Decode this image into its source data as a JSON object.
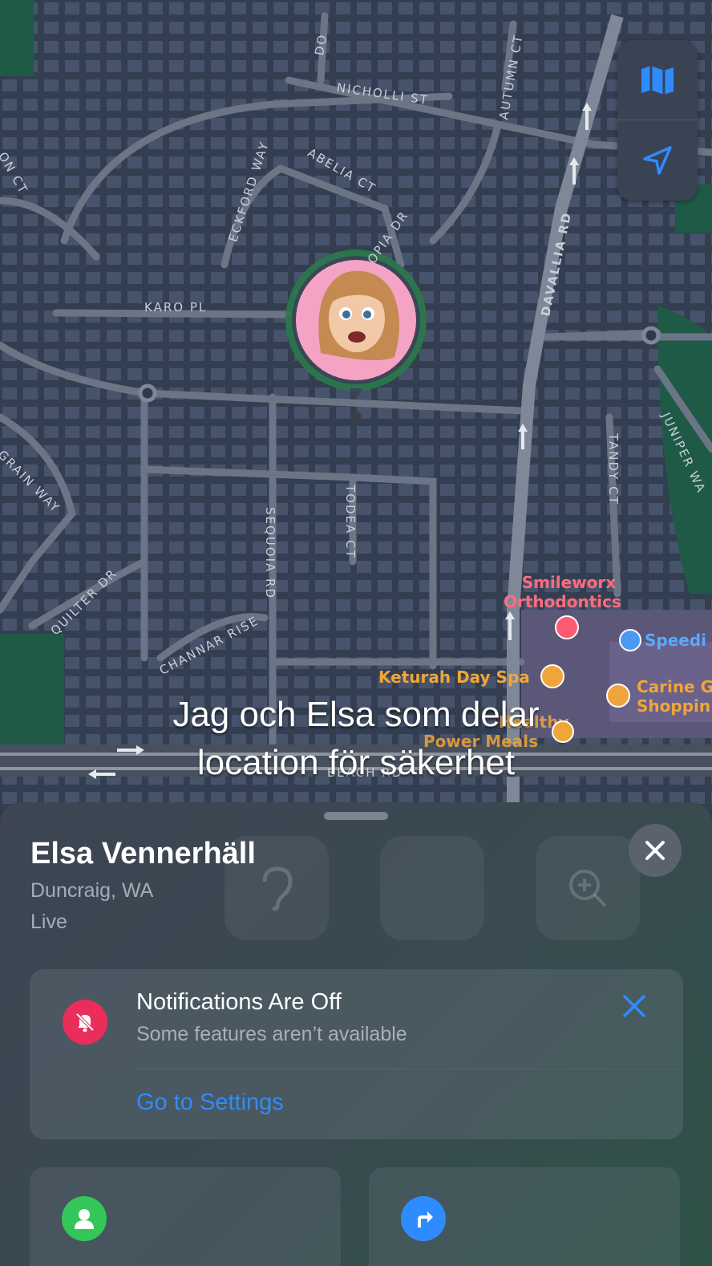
{
  "map": {
    "streets": [
      "NICHOLLI ST",
      "AUTUMN CT",
      "DO",
      "ABELIA CT",
      "ECKFORD WAY",
      "OPIA DR",
      "ON CT",
      "DAVALLIA RD",
      "KARO PL",
      "GRAIN WAY",
      "QUILTER DR",
      "SEQUOIA RD",
      "TODEA CT",
      "TANDY CT",
      "JUNIPER WA",
      "CHANNAR RISE",
      "BEACH RD"
    ],
    "places": {
      "orthodontics_line1": "Smileworx",
      "orthodontics_line2": "Orthodontics",
      "speed": "Speedi",
      "spa": "Keturah Day Spa",
      "shopping_line1": "Carine G",
      "shopping_line2": "Shoppin",
      "meals_line1": "Healthy",
      "meals_line2": "Power Meals"
    },
    "controls": {
      "map_mode_icon": "map-icon",
      "location_icon": "location-arrow-icon"
    },
    "accent_color": "#2f8cff"
  },
  "caption": {
    "line1": "Jag och Elsa som delar",
    "line2": "location för säkerhet"
  },
  "person": {
    "name": "Elsa Vennerhäll",
    "location": "Duncraig, WA",
    "status": "Live"
  },
  "notification": {
    "title": "Notifications Are Off",
    "subtitle": "Some features aren’t available",
    "link": "Go to Settings",
    "icon": "bell-slash-icon",
    "icon_color": "#ea2d5b"
  },
  "actions": [
    {
      "icon": "person-icon",
      "color": "#33c759"
    },
    {
      "icon": "directions-arrow-icon",
      "color": "#2f8cff"
    }
  ]
}
